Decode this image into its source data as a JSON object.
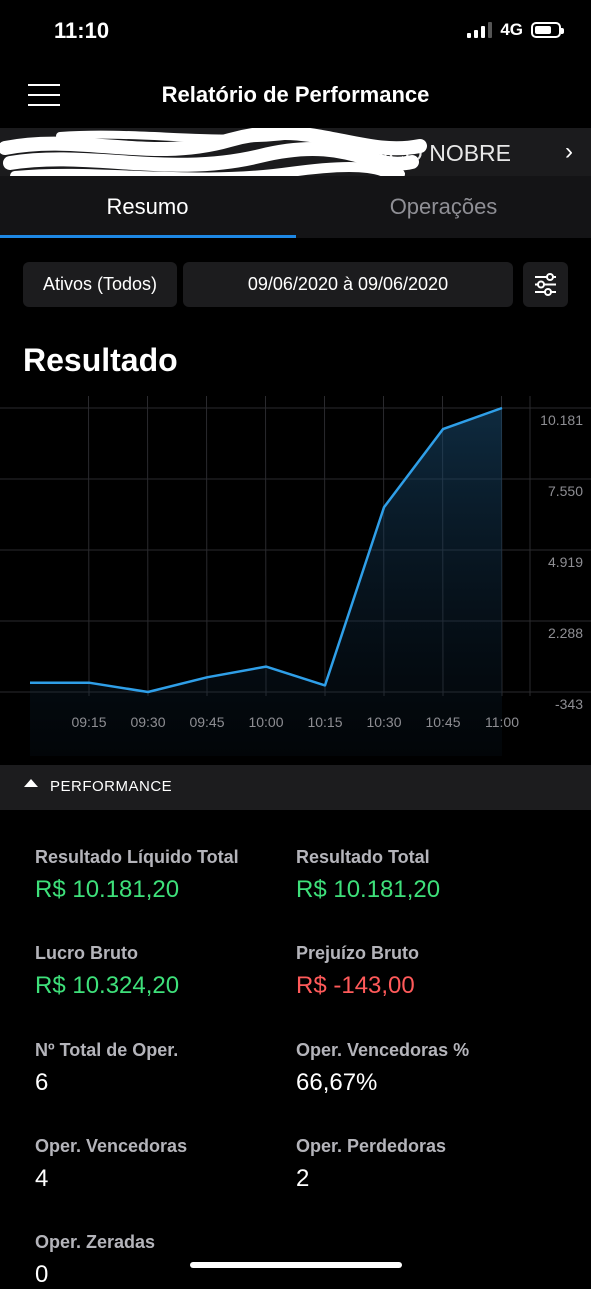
{
  "status": {
    "time": "11:10",
    "network": "4G"
  },
  "header": {
    "title": "Relatório de Performance",
    "menu_icon": "hamburger-menu-icon"
  },
  "account": {
    "name": "NCO NOBRE",
    "chevron_icon": "chevron-right-icon"
  },
  "tabs": [
    {
      "label": "Resumo",
      "active": true
    },
    {
      "label": "Operações",
      "active": false
    }
  ],
  "filters": {
    "assets": "Ativos (Todos)",
    "date_range": "09/06/2020 à 09/06/2020",
    "settings_icon": "sliders-icon"
  },
  "section": {
    "title": "Resultado"
  },
  "chart_data": {
    "type": "area",
    "x": [
      "09:00",
      "09:15",
      "09:30",
      "09:45",
      "10:00",
      "10:15",
      "10:30",
      "10:45",
      "11:00"
    ],
    "x_tick_labels": [
      "09:15",
      "09:30",
      "09:45",
      "10:00",
      "10:15",
      "10:30",
      "10:45",
      "11:00"
    ],
    "values": [
      1.3,
      0.9,
      -343,
      200,
      600,
      -100,
      6500,
      9400,
      10181
    ],
    "y_tick_labels": [
      "10.181",
      "7.550",
      "4.919",
      "2.288",
      "-343"
    ],
    "y_ticks": [
      10181,
      7550,
      4919,
      2288,
      -343
    ],
    "ylim": [
      -343,
      10181
    ],
    "grid": true,
    "line_color": "#2f9fe8"
  },
  "performance": {
    "label": "PERFORMANCE",
    "items": [
      {
        "label": "Resultado Líquido Total",
        "value": "R$ 10.181,20",
        "tone": "green"
      },
      {
        "label": "Resultado Total",
        "value": "R$ 10.181,20",
        "tone": "green"
      },
      {
        "label": "Lucro Bruto",
        "value": "R$ 10.324,20",
        "tone": "green"
      },
      {
        "label": "Prejuízo Bruto",
        "value": "R$ -143,00",
        "tone": "red"
      },
      {
        "label": "Nº Total de Oper.",
        "value": "6",
        "tone": "white"
      },
      {
        "label": "Oper. Vencedoras %",
        "value": "66,67%",
        "tone": "white"
      },
      {
        "label": "Oper. Vencedoras",
        "value": "4",
        "tone": "white"
      },
      {
        "label": "Oper. Perdedoras",
        "value": "2",
        "tone": "white"
      },
      {
        "label": "Oper. Zeradas",
        "value": "0",
        "tone": "white"
      }
    ]
  },
  "colors": {
    "accent": "#1e88e5",
    "positive": "#3ee07a",
    "negative": "#ff5a5a"
  }
}
